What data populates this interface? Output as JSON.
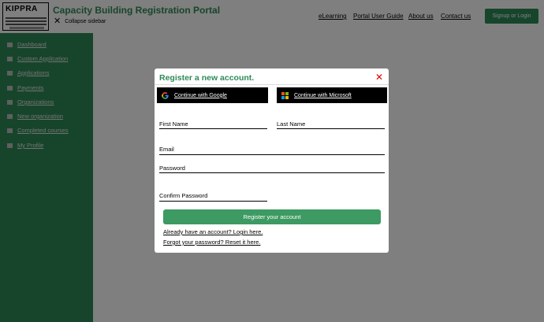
{
  "app": {
    "title": "Capacity Building Registration Portal",
    "collapse_label": "Collapse sidebar",
    "logo_text": "KIPPRA",
    "accent_color": "#2e8b57"
  },
  "top_nav": [
    {
      "label": "eLearning"
    },
    {
      "label": "Portal User Guide"
    },
    {
      "label": "About us"
    },
    {
      "label": "Contact us"
    }
  ],
  "signup_label": "Signup or Login",
  "sidebar": {
    "items": [
      {
        "label": "Dashboard",
        "icon": "grid-icon"
      },
      {
        "label": "Custom Application",
        "icon": "file-icon"
      },
      {
        "label": "Applications",
        "icon": "file-icon"
      },
      {
        "label": "Payments",
        "icon": "card-icon"
      },
      {
        "label": "Organizations",
        "icon": "folder-icon"
      },
      {
        "label": "New organization",
        "icon": "folder-icon"
      },
      {
        "label": "Completed courses",
        "icon": "check-icon"
      },
      {
        "label": "My Profile",
        "icon": "user-icon"
      }
    ]
  },
  "modal": {
    "title": "Register a new account.",
    "close_glyph": "✕",
    "google_label": "Continue with Google",
    "microsoft_label": "Continue with Microsoft",
    "fields": {
      "first_name": "First Name",
      "last_name": "Last Name",
      "email": "Email",
      "password": "Password",
      "confirm_password": "Confirm Password"
    },
    "register_label": "Register your account",
    "login_link": "Already have an account? Login here.",
    "reset_link": "Forgot your password? Reset it here."
  }
}
